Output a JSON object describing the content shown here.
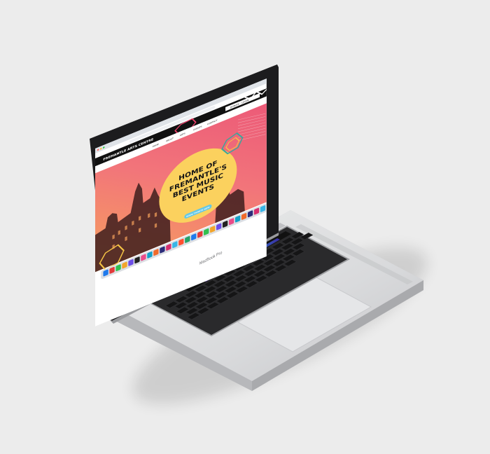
{
  "site": {
    "brand": "FREMANTLE ARTS CENTRE",
    "account_links": "DONATE · LOGIN",
    "nav": [
      "HOME",
      "ABOUT",
      "ARTS",
      "EVENTS",
      "CONTACT"
    ],
    "hero_heading": [
      "HOME OF",
      "FREMANTLE'S",
      "BEST MUSIC",
      "EVENTS"
    ],
    "cta_label": "BOOK TICKETS NOW"
  },
  "device": {
    "model_label": "MacBook Pro"
  },
  "colors": {
    "background": "#ececec",
    "hero_pink": "#ec5a78",
    "hero_orange": "#f6a25c",
    "circle_yellow": "#fbd15e",
    "hexagon_teal": "#3aa69c",
    "hexagon_yellow": "#f6c545",
    "cta_cyan": "#63c8e6",
    "bezel": "#1c1c1e",
    "aluminium": "#d6d7d9"
  }
}
